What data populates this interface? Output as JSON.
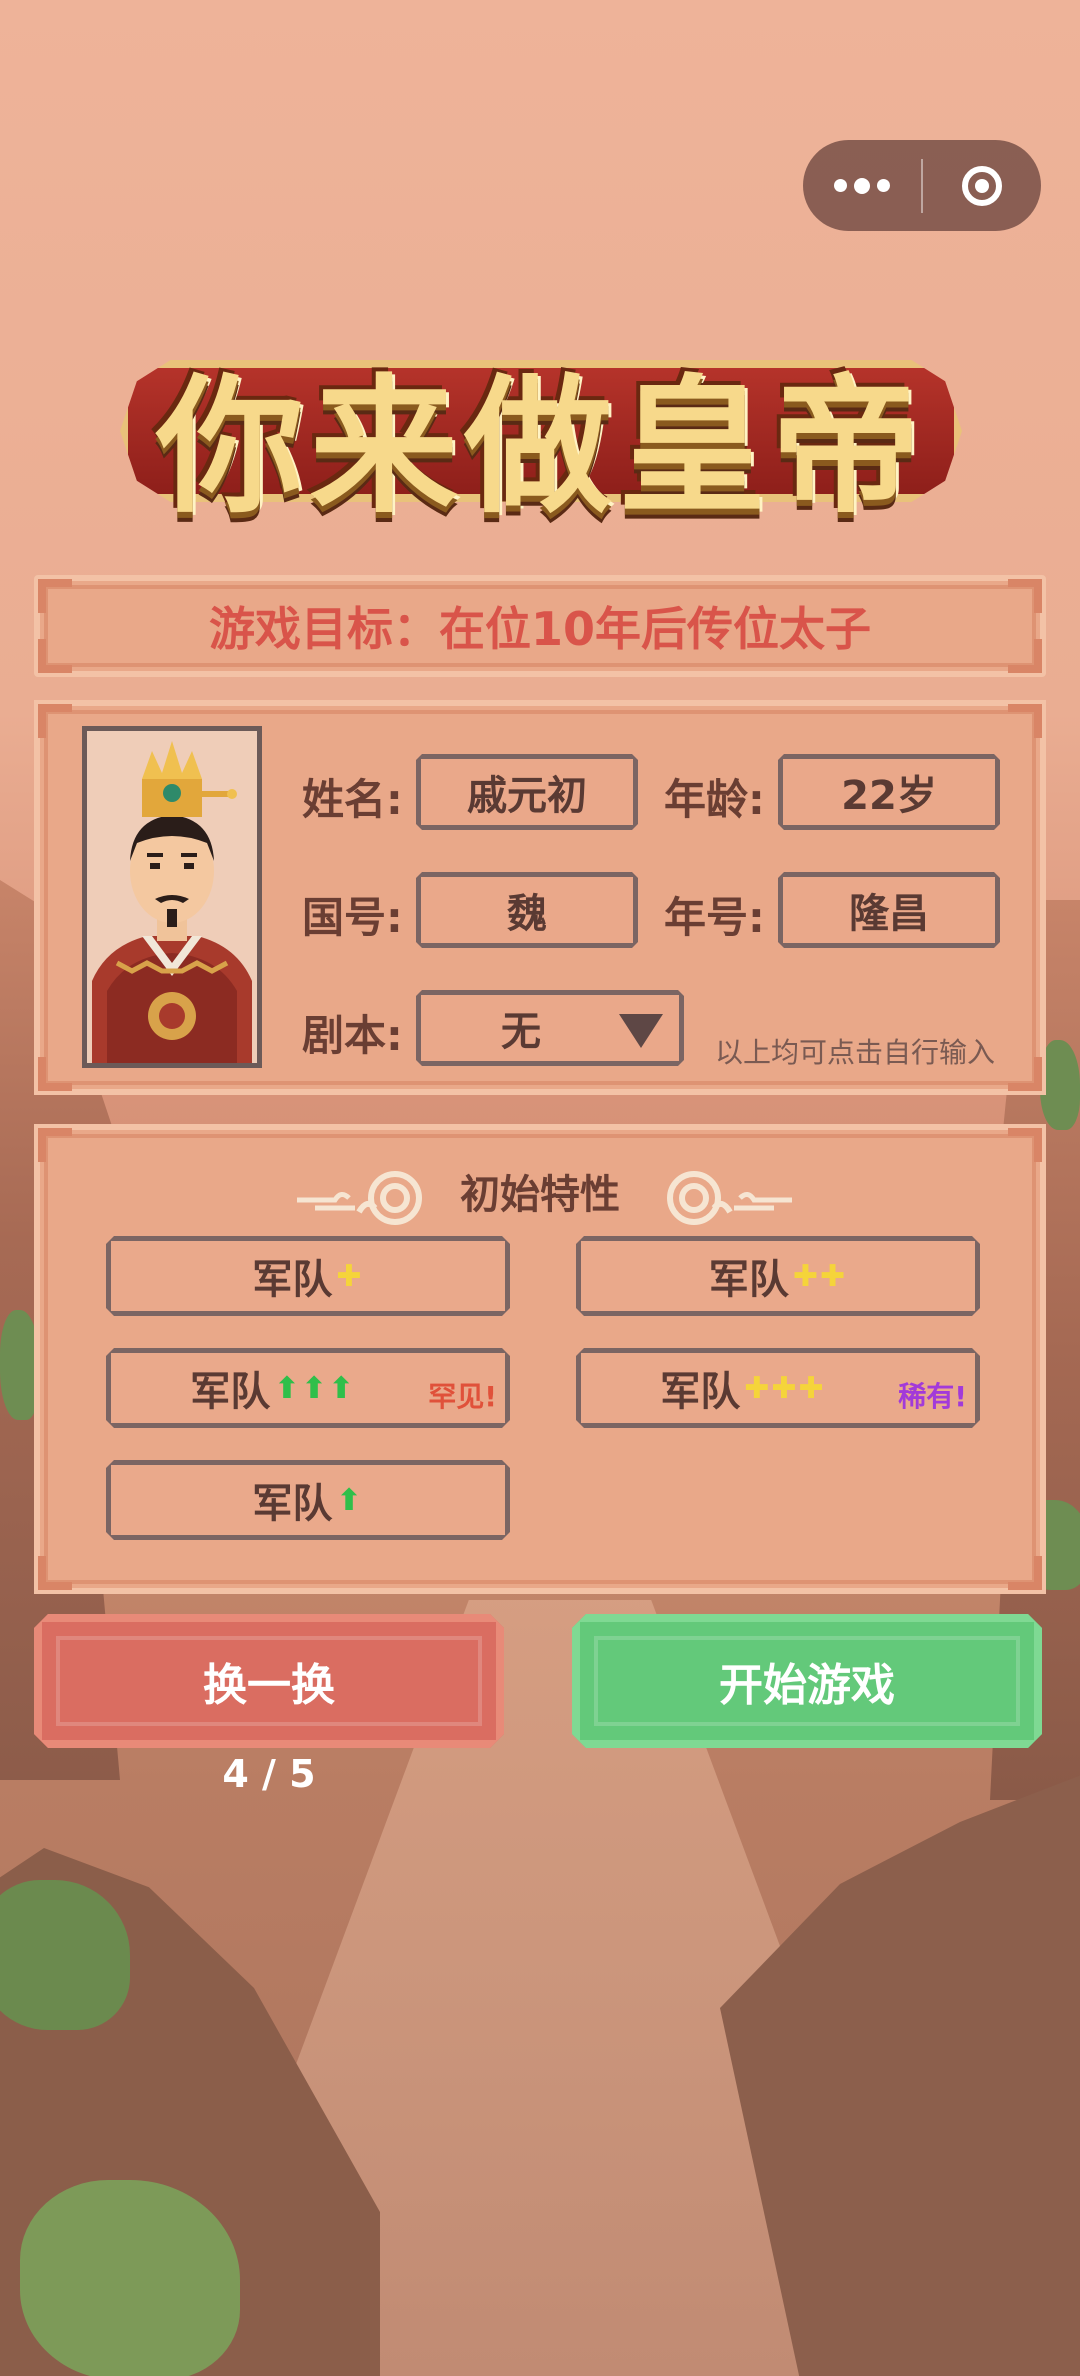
{
  "title": "你来做皇帝",
  "capsule": {
    "more": "more-menu",
    "close": "mini-program-close"
  },
  "goal": {
    "text": "游戏目标：在位10年后传位太子"
  },
  "info": {
    "name_label": "姓名:",
    "name_value": "戚元初",
    "age_label": "年龄:",
    "age_value": "22岁",
    "country_label": "国号:",
    "country_value": "魏",
    "era_label": "年号:",
    "era_value": "隆昌",
    "script_label": "剧本:",
    "script_value": "无",
    "hint": "以上均可点击自行输入"
  },
  "traits": {
    "title": "初始特性",
    "items": [
      {
        "label": "军队",
        "symbols": "✚",
        "kind": "plus",
        "tag": ""
      },
      {
        "label": "军队",
        "symbols": "✚✚",
        "kind": "plus",
        "tag": ""
      },
      {
        "label": "军队",
        "symbols": "⬆⬆⬆",
        "kind": "up",
        "tag": "罕见!",
        "tag_color": "#e0513a"
      },
      {
        "label": "军队",
        "symbols": "✚✚✚",
        "kind": "plus",
        "tag": "稀有!",
        "tag_color": "#a23ad9"
      },
      {
        "label": "军队",
        "symbols": "⬆",
        "kind": "up",
        "tag": ""
      }
    ]
  },
  "buttons": {
    "refresh": "换一换",
    "start": "开始游戏",
    "counter": "4 / 5"
  },
  "colors": {
    "goal_text": "#d9544a",
    "refresh": "#da6d61",
    "start": "#63c97a",
    "panel": "#e9a889"
  }
}
